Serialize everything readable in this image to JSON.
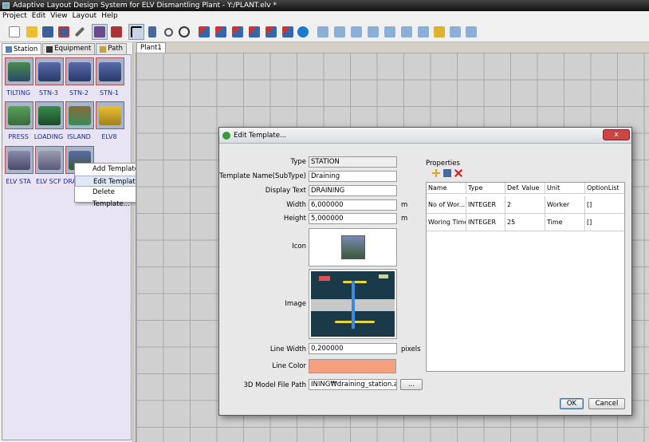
{
  "window": {
    "title": "Adaptive Layout Design System for ELV Dismantling Plant - Y:/PLANT.elv *"
  },
  "menu": [
    "Project",
    "Edit",
    "View",
    "Layout",
    "Help"
  ],
  "toolbar": {
    "icons": [
      "new-icon",
      "open-icon",
      "save-icon",
      "save-as-icon",
      "tools-icon",
      "station-mode-icon",
      "equipment-mode-icon",
      "select-icon",
      "delete-icon",
      "zoom-icon",
      "pan-icon",
      "conveyor-1-icon",
      "conveyor-2-icon",
      "conveyor-3-icon",
      "conveyor-4-icon",
      "conveyor-5-icon",
      "conveyor-6-icon",
      "play-icon",
      "align-left-icon",
      "align-center-icon",
      "align-right-icon",
      "align-top-icon",
      "align-middle-icon",
      "align-bottom-icon",
      "distribute-icon",
      "group-icon",
      "ungroup-icon"
    ]
  },
  "left_panel": {
    "tabs": [
      {
        "label": "Station",
        "active": true
      },
      {
        "label": "Equipment",
        "active": false
      },
      {
        "label": "Path",
        "active": false
      }
    ],
    "templates": [
      "TILTING",
      "STN-3",
      "STN-2",
      "STN-1",
      "PRESS",
      "LOADING",
      "ISLAND",
      "ELV8",
      "ELV STA",
      "ELV SCF",
      "DRAINING"
    ],
    "context_menu": {
      "items": [
        "Add Template...",
        "Edit Template...",
        "Delete Template..."
      ],
      "highlighted": "Edit Template..."
    }
  },
  "document_tab": "Plant1",
  "dialog": {
    "title": "Edit Template...",
    "close_label": "x",
    "labels": {
      "type": "Type",
      "template_name": "Template Name(SubType)",
      "display_text": "Display Text",
      "width": "Width",
      "height": "Height",
      "icon": "Icon",
      "image": "Image",
      "line_width": "Line Width",
      "line_color": "Line Color",
      "model_path": "3D Model File Path"
    },
    "values": {
      "type": "STATION",
      "template_name": "Draining",
      "display_text": "DRAINING",
      "width": "6,000000",
      "height": "5,000000",
      "line_width": "0,200000",
      "line_color": "#f7a080",
      "model_path": "INING₩draining_station.asm"
    },
    "units": {
      "width": "m",
      "height": "m",
      "line_width": "pixels"
    },
    "browse_label": "...",
    "properties": {
      "label": "Properties",
      "columns": [
        "Name",
        "Type",
        "Def. Value",
        "Unit",
        "OptionList"
      ],
      "rows": [
        [
          "No of Wor...",
          "INTEGER",
          "2",
          "Worker",
          "[]"
        ],
        [
          "Woring Time",
          "INTEGER",
          "25",
          "Time",
          "[]"
        ]
      ]
    },
    "ok_label": "OK",
    "cancel_label": "Cancel"
  }
}
